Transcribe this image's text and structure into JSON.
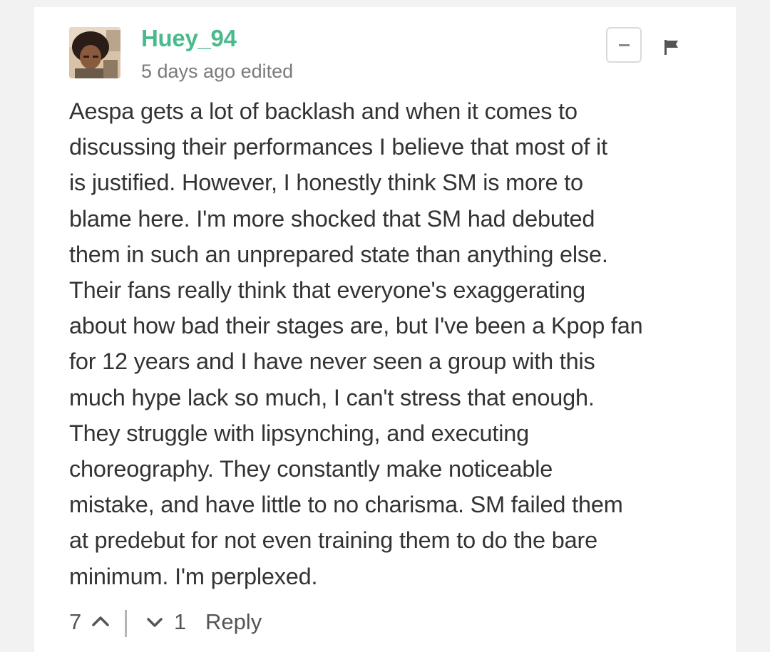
{
  "comment": {
    "username": "Huey_94",
    "meta": "5 days ago edited",
    "body": "Aespa gets a lot of backlash and when it comes to\ndiscussing their performances I believe that most of it\nis justified. However, I honestly think SM is more to\nblame here. I'm more shocked that SM had debuted\nthem in such an unprepared state than anything else.\nTheir fans really think that everyone's exaggerating\nabout how bad their stages are, but I've been a Kpop fan\nfor 12 years and I have never seen a group with this\nmuch hype lack so much, I can't stress that enough.\nThey struggle with lipsynching, and executing\nchoreography. They constantly make noticeable\nmistake, and have little to no charisma. SM failed them\nat predebut for not even training them to do the bare\nminimum. I'm perplexed.",
    "upvotes": "7",
    "downvotes": "1",
    "reply_label": "Reply"
  },
  "icons": {
    "collapse": "minus-icon",
    "flag": "flag-icon",
    "upvote": "chevron-up-icon",
    "downvote": "chevron-down-icon"
  },
  "colors": {
    "username": "#4aba8c",
    "meta": "#7a7a7a",
    "body": "#333333",
    "controls": "#555555"
  }
}
